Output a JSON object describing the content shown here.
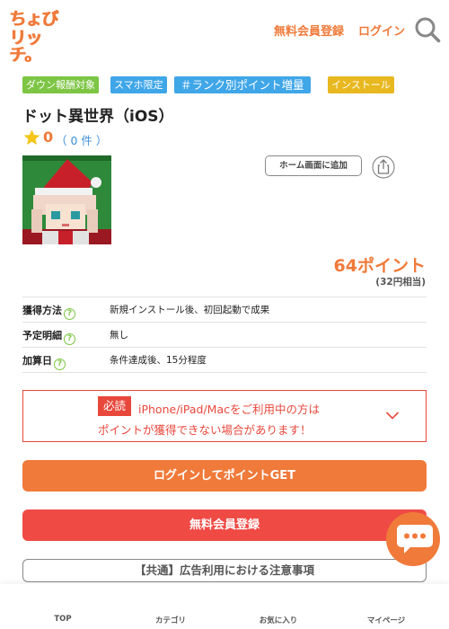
{
  "header": {
    "logo_line1": "ちょび",
    "logo_line2": "リッチ。",
    "signup_link": "無料会員登録",
    "login_link": "ログイン",
    "search_icon": "search-icon",
    "brand_color": "#f07a3a"
  },
  "tags": [
    {
      "label": "ダウン報酬対象",
      "color": "#7dc544"
    },
    {
      "label": "スマホ限定",
      "color": "#3fa6e8"
    },
    {
      "label": "＃ランク別ポイント増量",
      "color": "#3fa6e8"
    },
    {
      "label": "インストール",
      "color": "#e8b820"
    }
  ],
  "app": {
    "title": "ドット異世界（iOS）",
    "rating_score": "0",
    "rating_count": "（ 0 件 ）",
    "icon": "app-icon-image"
  },
  "actions": {
    "home_screen_button": "ホーム画面に追加",
    "share_icon": "share-icon"
  },
  "reward": {
    "points": "64ポイント",
    "yen": "(32円相当)"
  },
  "info": [
    {
      "key": "獲得方法",
      "value": "新規インストール後、初回起動で成果"
    },
    {
      "key": "予定明細",
      "value": "無し"
    },
    {
      "key": "加算日",
      "value": "条件達成後、15分程度"
    }
  ],
  "notice": {
    "badge": "必読",
    "line1": "iPhone/iPad/Macをご利用中の方は",
    "line2": "ポイントが獲得できない場合があります！",
    "color": "#e8483c"
  },
  "buttons": {
    "login_get": "ログインしてポイントGET",
    "free_signup": "無料会員登録",
    "caution": "【共通】広告利用における注意事項"
  },
  "bottom_nav": [
    {
      "label": "TOP",
      "icon": "home-icon"
    },
    {
      "label": "カテゴリ",
      "icon": "category-icon"
    },
    {
      "label": "お気に入り",
      "icon": "favorite-icon"
    },
    {
      "label": "マイページ",
      "icon": "mypage-icon"
    }
  ]
}
